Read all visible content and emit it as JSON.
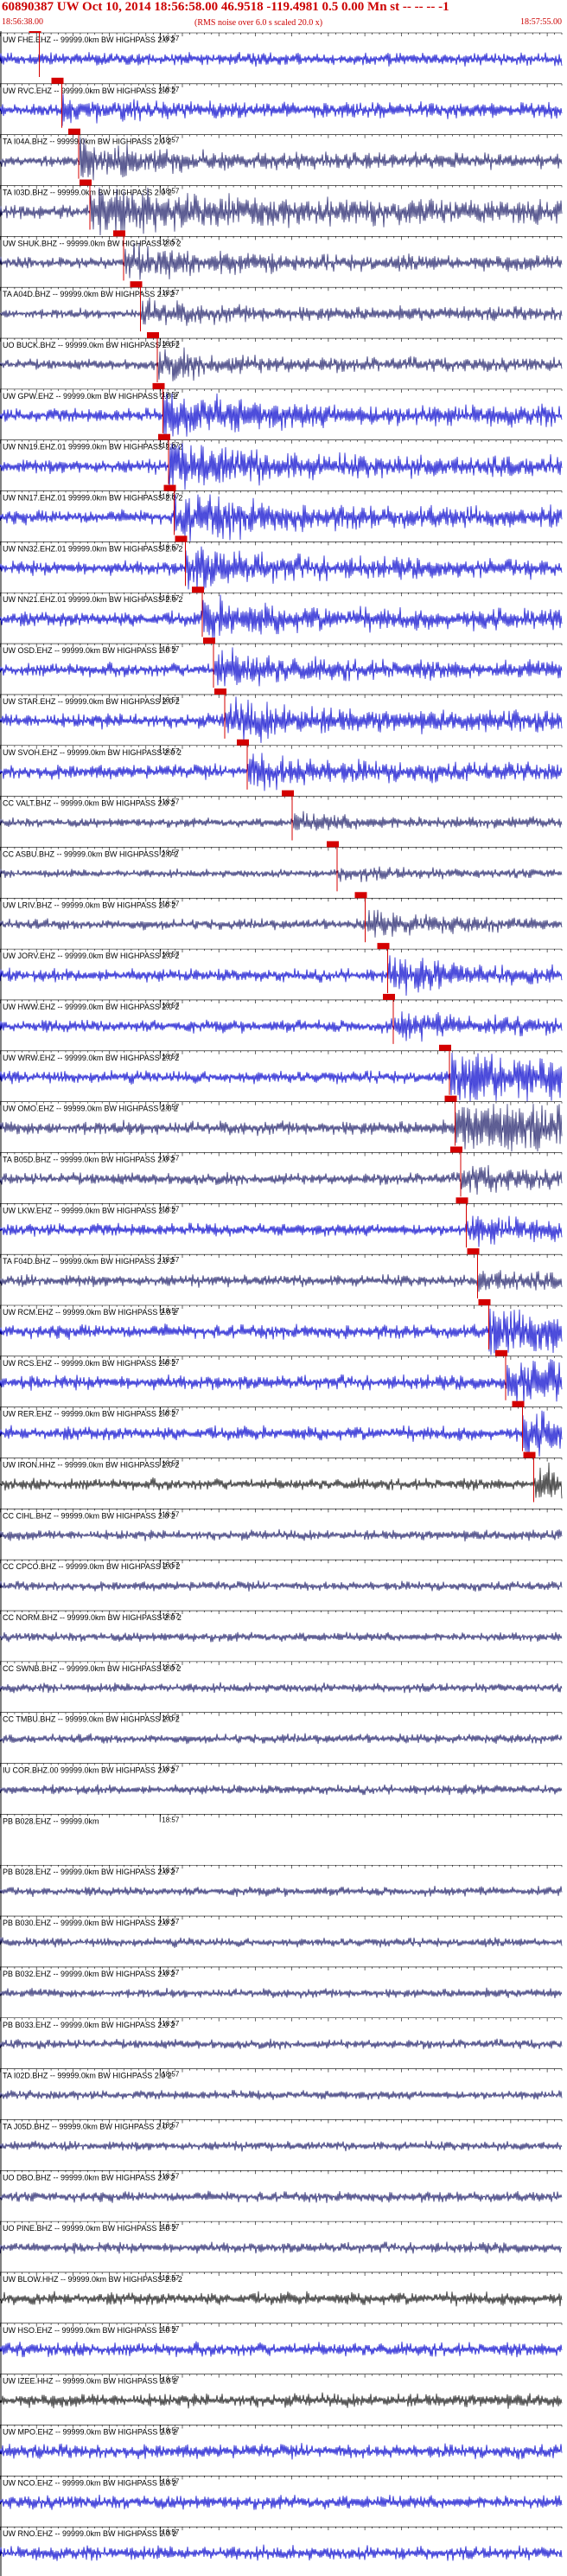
{
  "header": {
    "title": "60890387 UW Oct 10, 2014 18:56:58.00   46.9518 -119.4981  0.5 0.00 Mn st -- -- --   -1",
    "start_time": "18:56:38.00",
    "note": "(RMS noise over 6.0 s scaled 20.0 x)",
    "end_time": "18:57:55.00"
  },
  "chart_data": {
    "type": "line",
    "minute_tick_label": "18:57",
    "time_range": [
      "18:56:38.00",
      "18:57:55.00"
    ],
    "traces": [
      {
        "label": "UW FHE.EHZ -- 99999.0km BW  HIGHPASS  2.0  2",
        "color": "#0000cc",
        "pick": 0.07,
        "amp": 0.55,
        "burst": 0.0
      },
      {
        "label": "UW RVC.EHZ -- 99999.0km BW  HIGHPASS  2.0  2",
        "color": "#0000cc",
        "pick": 0.11,
        "amp": 0.55,
        "burst": 0.6
      },
      {
        "label": "TA I04A.BHZ -- 99999.0km BW  HIGHPASS  2.0  2",
        "color": "#1a1a66",
        "pick": 0.14,
        "amp": 0.45,
        "burst": 1.6
      },
      {
        "label": "TA I03D.BHZ -- 99999.0km BW  HIGHPASS  2.0  2",
        "color": "#1a1a66",
        "pick": 0.16,
        "amp": 0.6,
        "burst": 2.6
      },
      {
        "label": "UW SHUK.BHZ -- 99999.0km BW  HIGHPASS  2.0  2",
        "color": "#1a1a66",
        "pick": 0.22,
        "amp": 0.5,
        "burst": 1.2
      },
      {
        "label": "TA A04D.BHZ -- 99999.0km BW  HIGHPASS  2.0  2",
        "color": "#1a1a66",
        "pick": 0.25,
        "amp": 0.45,
        "burst": 0.9
      },
      {
        "label": "UO BUCK.BHZ -- 99999.0km BW  HIGHPASS  2.0  2",
        "color": "#1a1a66",
        "pick": 0.28,
        "amp": 0.45,
        "burst": 1.0
      },
      {
        "label": "UW GPW.EHZ -- 99999.0km BW  HIGHPASS  2.0  2",
        "color": "#0000cc",
        "pick": 0.29,
        "amp": 0.6,
        "burst": 1.6
      },
      {
        "label": "UW NN19.EHZ.01 99999.0km BW  HIGHPASS  2.0  2",
        "color": "#0000cc",
        "pick": 0.3,
        "amp": 0.6,
        "burst": 1.7
      },
      {
        "label": "UW NN17.EHZ.01 99999.0km BW  HIGHPASS  2.0  2",
        "color": "#0000cc",
        "pick": 0.31,
        "amp": 0.6,
        "burst": 1.6
      },
      {
        "label": "UW NN32.EHZ.01 99999.0km BW  HIGHPASS  2.0  2",
        "color": "#0000cc",
        "pick": 0.33,
        "amp": 0.6,
        "burst": 1.2
      },
      {
        "label": "UW NN21.EHZ.01 99999.0km BW  HIGHPASS  2.0  2",
        "color": "#0000cc",
        "pick": 0.36,
        "amp": 0.65,
        "burst": 1.0
      },
      {
        "label": "UW OSD.EHZ -- 99999.0km BW  HIGHPASS  2.0  2",
        "color": "#0000cc",
        "pick": 0.38,
        "amp": 0.6,
        "burst": 1.0
      },
      {
        "label": "UW STAR.EHZ -- 99999.0km BW  HIGHPASS  2.0  2",
        "color": "#0000cc",
        "pick": 0.4,
        "amp": 0.65,
        "burst": 1.1
      },
      {
        "label": "UW SVOH.EHZ -- 99999.0km BW  HIGHPASS  2.0  2",
        "color": "#0000cc",
        "pick": 0.44,
        "amp": 0.6,
        "burst": 0.9
      },
      {
        "label": "CC VALT.BHZ -- 99999.0km BW  HIGHPASS  2.0  2",
        "color": "#1a1a66",
        "pick": 0.52,
        "amp": 0.4,
        "burst": 0.6
      },
      {
        "label": "CC ASBU.BHZ -- 99999.0km BW  HIGHPASS  2.0  2",
        "color": "#1a1a66",
        "pick": 0.6,
        "amp": 0.35,
        "burst": 0.5
      },
      {
        "label": "UW LRIV.BHZ -- 99999.0km BW  HIGHPASS  2.0  2",
        "color": "#1a1a66",
        "pick": 0.65,
        "amp": 0.45,
        "burst": 0.8
      },
      {
        "label": "UW JORV.EHZ -- 99999.0km BW  HIGHPASS  2.0  2",
        "color": "#0000cc",
        "pick": 0.69,
        "amp": 0.55,
        "burst": 0.9
      },
      {
        "label": "UW HWW.EHZ -- 99999.0km BW  HIGHPASS  2.0  2",
        "color": "#0000cc",
        "pick": 0.7,
        "amp": 0.55,
        "burst": 0.7
      },
      {
        "label": "UW WRW.EHZ -- 99999.0km BW  HIGHPASS  2.0  2",
        "color": "#0000cc",
        "pick": 0.8,
        "amp": 0.55,
        "burst": 3.2
      },
      {
        "label": "UW OMO.EHZ -- 99999.0km BW  HIGHPASS  2.0  2",
        "color": "#1a1a66",
        "pick": 0.81,
        "amp": 0.6,
        "burst": 2.8
      },
      {
        "label": "TA B05D.BHZ -- 99999.0km BW  HIGHPASS  2.0  2",
        "color": "#1a1a66",
        "pick": 0.82,
        "amp": 0.5,
        "burst": 0.8
      },
      {
        "label": "UW LKW.EHZ -- 99999.0km BW  HIGHPASS  2.0  2",
        "color": "#0000cc",
        "pick": 0.83,
        "amp": 0.55,
        "burst": 0.8
      },
      {
        "label": "TA F04D.BHZ -- 99999.0km BW  HIGHPASS  2.0  2",
        "color": "#1a1a66",
        "pick": 0.85,
        "amp": 0.5,
        "burst": 0.6
      },
      {
        "label": "UW RCM.EHZ -- 99999.0km BW  HIGHPASS  2.0  2",
        "color": "#0000cc",
        "pick": 0.87,
        "amp": 0.6,
        "burst": 2.0
      },
      {
        "label": "UW RCS.EHZ -- 99999.0km BW  HIGHPASS  2.0  2",
        "color": "#0000cc",
        "pick": 0.9,
        "amp": 0.6,
        "burst": 2.0
      },
      {
        "label": "UW RER.EHZ -- 99999.0km BW  HIGHPASS  2.0  2",
        "color": "#0000cc",
        "pick": 0.93,
        "amp": 0.6,
        "burst": 1.0
      },
      {
        "label": "UW IRON.HHZ -- 99999.0km BW  HIGHPASS  2.0  2",
        "color": "#111111",
        "pick": 0.95,
        "amp": 0.5,
        "burst": 1.2
      },
      {
        "label": "CC CIHL.BHZ -- 99999.0km BW  HIGHPASS  2.0  2",
        "color": "#1a1a66",
        "pick": null,
        "amp": 0.45,
        "burst": 0
      },
      {
        "label": "CC CPCO.BHZ -- 99999.0km BW  HIGHPASS  2.0  2",
        "color": "#1a1a66",
        "pick": null,
        "amp": 0.4,
        "burst": 0
      },
      {
        "label": "CC NORM.BHZ -- 99999.0km BW  HIGHPASS  2.0  2",
        "color": "#1a1a66",
        "pick": null,
        "amp": 0.4,
        "burst": 0
      },
      {
        "label": "CC SWNB.BHZ -- 99999.0km BW  HIGHPASS  2.0  2",
        "color": "#1a1a66",
        "pick": null,
        "amp": 0.4,
        "burst": 0
      },
      {
        "label": "CC TMBU.BHZ -- 99999.0km BW  HIGHPASS  2.0  2",
        "color": "#1a1a66",
        "pick": null,
        "amp": 0.4,
        "burst": 0
      },
      {
        "label": "IU COR.BHZ.00 99999.0km BW  HIGHPASS  2.0  2",
        "color": "#1a1a66",
        "pick": null,
        "amp": 0.4,
        "burst": 0
      },
      {
        "label": "PB B028.EHZ -- 99999.0km",
        "color": "#1a1a66",
        "pick": null,
        "amp": 0.0,
        "burst": 0
      },
      {
        "label": "PB B028.EHZ -- 99999.0km BW  HIGHPASS  2.0  2",
        "color": "#1a1a66",
        "pick": null,
        "amp": 0.4,
        "burst": 0
      },
      {
        "label": "PB B030.EHZ -- 99999.0km BW  HIGHPASS  2.0  2",
        "color": "#1a1a66",
        "pick": null,
        "amp": 0.4,
        "burst": 0
      },
      {
        "label": "PB B032.EHZ -- 99999.0km BW  HIGHPASS  2.0  2",
        "color": "#1a1a66",
        "pick": null,
        "amp": 0.4,
        "burst": 0
      },
      {
        "label": "PB B033.EHZ -- 99999.0km BW  HIGHPASS  2.0  2",
        "color": "#1a1a66",
        "pick": null,
        "amp": 0.4,
        "burst": 0
      },
      {
        "label": "TA I02D.BHZ -- 99999.0km BW  HIGHPASS  2.0  2",
        "color": "#1a1a66",
        "pick": null,
        "amp": 0.4,
        "burst": 0
      },
      {
        "label": "TA J05D.BHZ -- 99999.0km BW  HIGHPASS  2.0  2",
        "color": "#1a1a66",
        "pick": null,
        "amp": 0.4,
        "burst": 0
      },
      {
        "label": "UO DBO.BHZ -- 99999.0km BW  HIGHPASS  2.0  2",
        "color": "#1a1a66",
        "pick": null,
        "amp": 0.45,
        "burst": 0
      },
      {
        "label": "UO PINE.BHZ -- 99999.0km BW  HIGHPASS  2.0  2",
        "color": "#1a1a66",
        "pick": null,
        "amp": 0.45,
        "burst": 0
      },
      {
        "label": "UW BLOW.HHZ -- 99999.0km BW  HIGHPASS  2.0  2",
        "color": "#111111",
        "pick": null,
        "amp": 0.55,
        "burst": 0
      },
      {
        "label": "UW HSO.EHZ -- 99999.0km BW  HIGHPASS  2.0  2",
        "color": "#0000cc",
        "pick": null,
        "amp": 0.6,
        "burst": 0
      },
      {
        "label": "UW IZEE.HHZ -- 99999.0km BW  HIGHPASS  2.0  2",
        "color": "#111111",
        "pick": null,
        "amp": 0.6,
        "burst": 0
      },
      {
        "label": "UW MPO.EHZ -- 99999.0km BW  HIGHPASS  2.0  2",
        "color": "#0000cc",
        "pick": null,
        "amp": 0.6,
        "burst": 0
      },
      {
        "label": "UW NCO.EHZ -- 99999.0km BW  HIGHPASS  2.0  2",
        "color": "#0000cc",
        "pick": null,
        "amp": 0.6,
        "burst": 0
      },
      {
        "label": "UW RNO.EHZ -- 99999.0km BW  HIGHPASS  2.0  2",
        "color": "#0000cc",
        "pick": null,
        "amp": 0.6,
        "burst": 0
      }
    ]
  }
}
